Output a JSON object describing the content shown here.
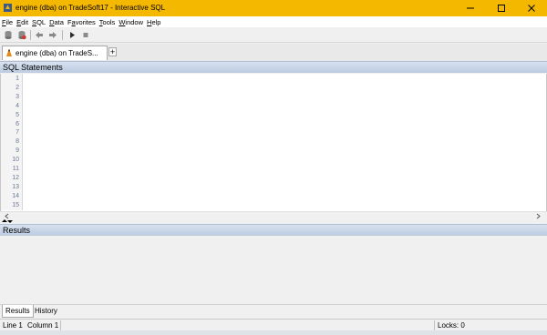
{
  "window": {
    "title": "engine (dba) on TradeSoft17 - Interactive SQL",
    "titlebar_color": "#f5b800"
  },
  "menu": [
    {
      "pre": "",
      "key": "F",
      "post": "ile"
    },
    {
      "pre": "",
      "key": "E",
      "post": "dit"
    },
    {
      "pre": "",
      "key": "S",
      "post": "QL"
    },
    {
      "pre": "",
      "key": "D",
      "post": "ata"
    },
    {
      "pre": "F",
      "key": "a",
      "post": "vorites"
    },
    {
      "pre": "",
      "key": "T",
      "post": "ools"
    },
    {
      "pre": "",
      "key": "W",
      "post": "indow"
    },
    {
      "pre": "",
      "key": "H",
      "post": "elp"
    }
  ],
  "toolbar": {
    "icons": [
      "disconnect-icon",
      "connect-icon",
      "back-icon",
      "forward-icon",
      "execute-icon",
      "stop-icon"
    ]
  },
  "doc_tab": {
    "label": "engine (dba) on TradeS...",
    "add_label": "+"
  },
  "sql_pane": {
    "title": "SQL Statements",
    "line_numbers": [
      "1",
      "2",
      "3",
      "4",
      "5",
      "6",
      "7",
      "8",
      "9",
      "10",
      "11",
      "12",
      "13",
      "14",
      "15"
    ]
  },
  "results_pane": {
    "title": "Results"
  },
  "bottom_tabs": [
    "Results",
    "History"
  ],
  "status": {
    "line": "Line 1",
    "column": "Column 1",
    "locks": "Locks: 0"
  }
}
